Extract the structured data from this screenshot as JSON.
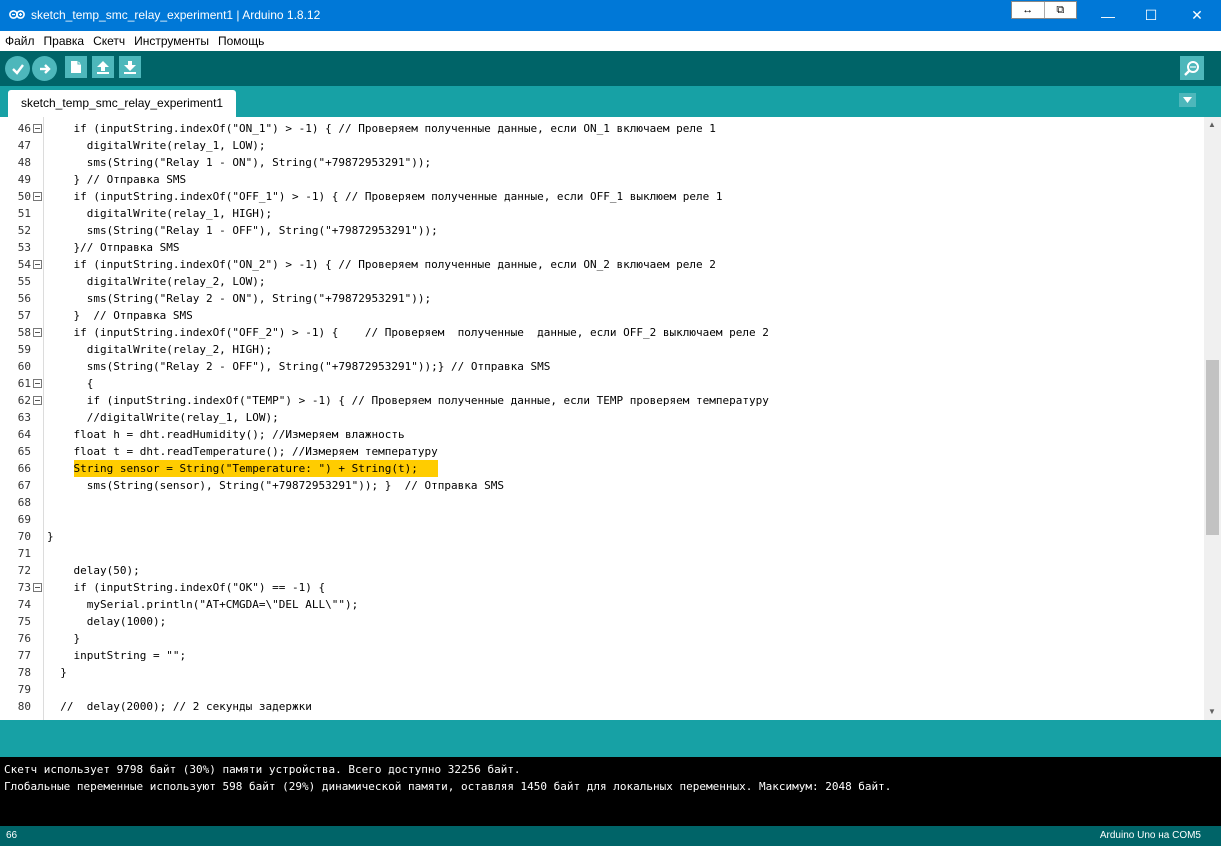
{
  "window": {
    "title": "sketch_temp_smc_relay_experiment1 | Arduino 1.8.12",
    "extra_buttons": [
      "↔",
      "⧉"
    ],
    "minimize": "—",
    "maximize": "☐",
    "close": "✕"
  },
  "menu": [
    "Файл",
    "Правка",
    "Скетч",
    "Инструменты",
    "Помощь"
  ],
  "toolbar": {
    "buttons": [
      "verify-icon",
      "upload-icon",
      "new-icon",
      "open-icon",
      "save-icon"
    ],
    "serial_monitor": "serial-monitor-icon"
  },
  "tabs": {
    "active": "sketch_temp_smc_relay_experiment1",
    "menu_icon": "tab-menu-icon"
  },
  "editor": {
    "highlight_color": "#ffcc00",
    "lines": [
      {
        "n": "46",
        "fold": true,
        "text": "    if (inputString.indexOf(\"ON_1\") > -1) { // Проверяем полученные данные, если ON_1 включаем реле 1"
      },
      {
        "n": "47",
        "fold": false,
        "text": "      digitalWrite(relay_1, LOW);"
      },
      {
        "n": "48",
        "fold": false,
        "text": "      sms(String(\"Relay 1 - ON\"), String(\"+79872953291\"));"
      },
      {
        "n": "49",
        "fold": false,
        "text": "    } // Отправка SMS"
      },
      {
        "n": "50",
        "fold": true,
        "text": "    if (inputString.indexOf(\"OFF_1\") > -1) { // Проверяем полученные данные, если OFF_1 выклюем реле 1"
      },
      {
        "n": "51",
        "fold": false,
        "text": "      digitalWrite(relay_1, HIGH);"
      },
      {
        "n": "52",
        "fold": false,
        "text": "      sms(String(\"Relay 1 - OFF\"), String(\"+79872953291\"));"
      },
      {
        "n": "53",
        "fold": false,
        "text": "    }// Отправка SMS"
      },
      {
        "n": "54",
        "fold": true,
        "text": "    if (inputString.indexOf(\"ON_2\") > -1) { // Проверяем полученные данные, если ON_2 включаем реле 2"
      },
      {
        "n": "55",
        "fold": false,
        "text": "      digitalWrite(relay_2, LOW);"
      },
      {
        "n": "56",
        "fold": false,
        "text": "      sms(String(\"Relay 2 - ON\"), String(\"+79872953291\"));"
      },
      {
        "n": "57",
        "fold": false,
        "text": "    }  // Отправка SMS"
      },
      {
        "n": "58",
        "fold": true,
        "text": "    if (inputString.indexOf(\"OFF_2\") > -1) {    // Проверяем  полученные  данные, если OFF_2 выключаем реле 2"
      },
      {
        "n": "59",
        "fold": false,
        "text": "      digitalWrite(relay_2, HIGH);"
      },
      {
        "n": "60",
        "fold": false,
        "text": "      sms(String(\"Relay 2 - OFF\"), String(\"+79872953291\"));} // Отправка SMS"
      },
      {
        "n": "61",
        "fold": true,
        "text": "      {"
      },
      {
        "n": "62",
        "fold": true,
        "text": "      if (inputString.indexOf(\"TEMP\") > -1) { // Проверяем полученные данные, если TEMP проверяем температуру"
      },
      {
        "n": "63",
        "fold": false,
        "text": "      //digitalWrite(relay_1, LOW);"
      },
      {
        "n": "64",
        "fold": false,
        "text": "    float h = dht.readHumidity(); //Измеряем влажность"
      },
      {
        "n": "65",
        "fold": false,
        "text": "    float t = dht.readTemperature(); //Измеряем температуру"
      },
      {
        "n": "66",
        "fold": false,
        "highlight": true,
        "text": "    String sensor = String(\"Temperature: \") + String(t);"
      },
      {
        "n": "67",
        "fold": false,
        "text": "      sms(String(sensor), String(\"+79872953291\")); }  // Отправка SMS"
      },
      {
        "n": "68",
        "fold": false,
        "text": ""
      },
      {
        "n": "69",
        "fold": false,
        "text": ""
      },
      {
        "n": "70",
        "fold": false,
        "text": "}"
      },
      {
        "n": "71",
        "fold": false,
        "text": ""
      },
      {
        "n": "72",
        "fold": false,
        "text": "    delay(50);"
      },
      {
        "n": "73",
        "fold": true,
        "text": "    if (inputString.indexOf(\"OK\") == -1) {"
      },
      {
        "n": "74",
        "fold": false,
        "text": "      mySerial.println(\"AT+CMGDA=\\\"DEL ALL\\\"\");"
      },
      {
        "n": "75",
        "fold": false,
        "text": "      delay(1000);"
      },
      {
        "n": "76",
        "fold": false,
        "text": "    }"
      },
      {
        "n": "77",
        "fold": false,
        "text": "    inputString = \"\";"
      },
      {
        "n": "78",
        "fold": false,
        "text": "  }"
      },
      {
        "n": "79",
        "fold": false,
        "text": ""
      },
      {
        "n": "80",
        "fold": false,
        "text": "  //  delay(2000); // 2 секунды задержки"
      }
    ]
  },
  "console": {
    "lines": [
      "Скетч использует 9798 байт (30%) памяти устройства. Всего доступно 32256 байт.",
      "Глобальные переменные используют 598 байт (29%) динамической памяти, оставляя 1450 байт для локальных переменных. Максимум: 2048 байт."
    ]
  },
  "status": {
    "line_number": "66",
    "board": "Arduino Uno на COM5"
  }
}
